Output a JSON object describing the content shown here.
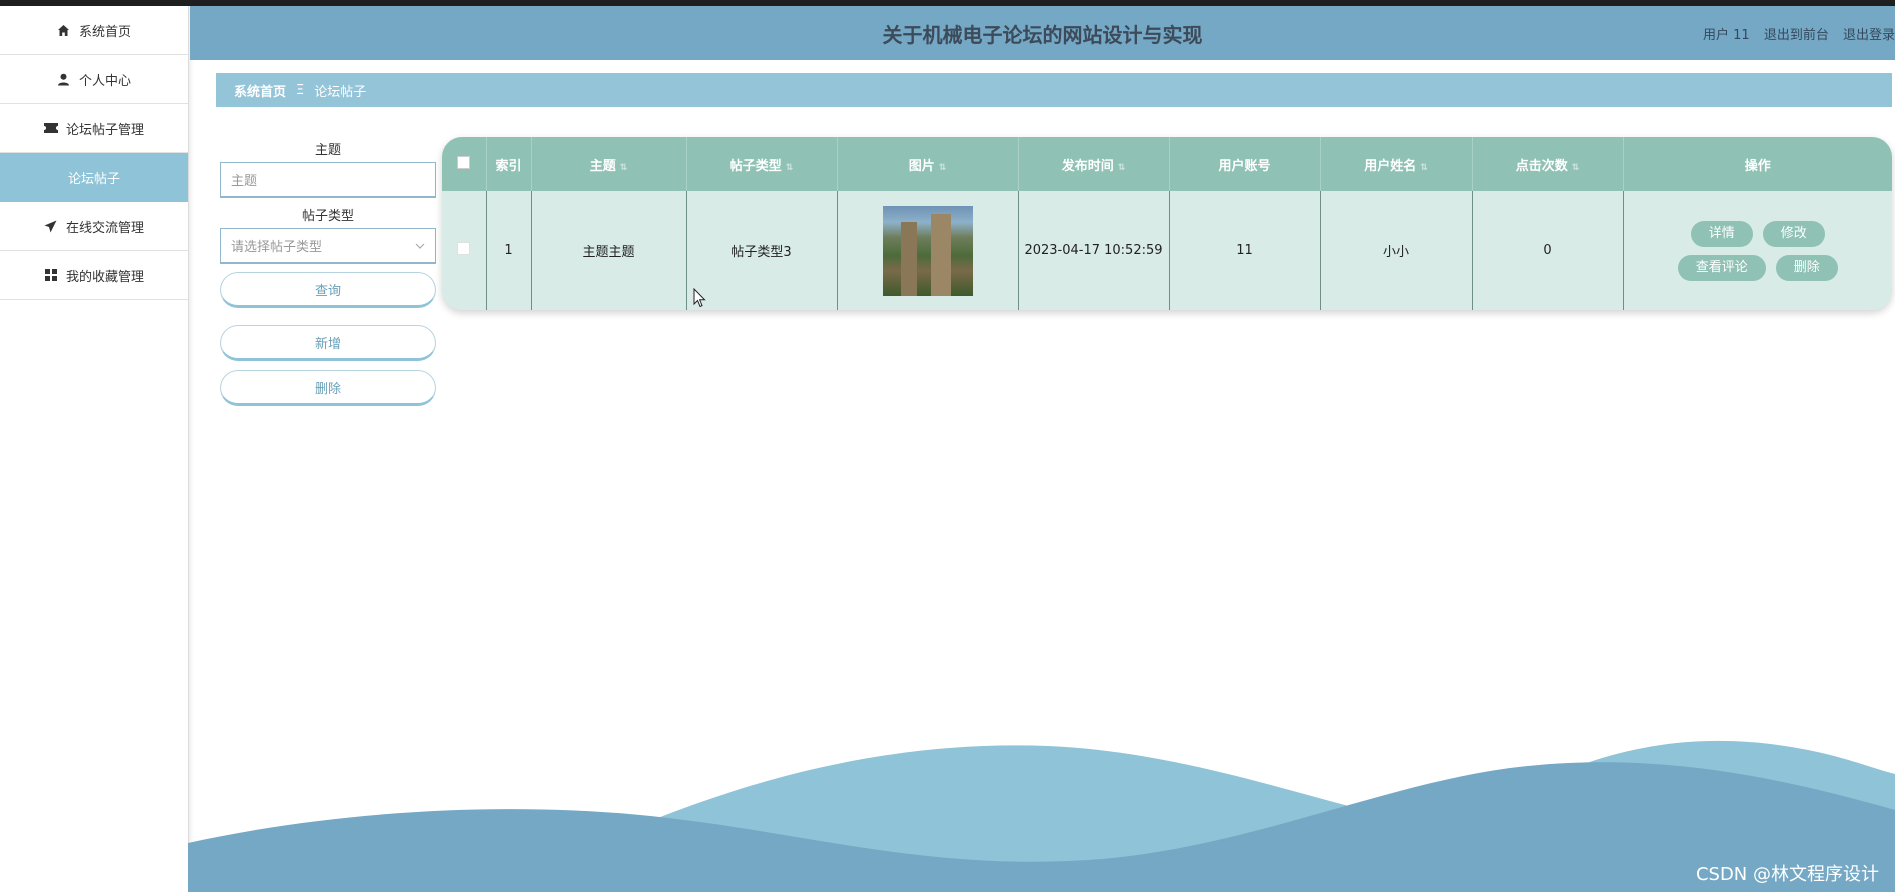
{
  "sidebar": {
    "items": [
      {
        "label": "系统首页",
        "icon": "home-icon"
      },
      {
        "label": "个人中心",
        "icon": "user-icon"
      },
      {
        "label": "论坛帖子管理",
        "icon": "ticket-icon"
      },
      {
        "label": "论坛帖子",
        "icon": ""
      },
      {
        "label": "在线交流管理",
        "icon": "send-icon"
      },
      {
        "label": "我的收藏管理",
        "icon": "grid-icon"
      }
    ]
  },
  "header": {
    "title": "关于机械电子论坛的网站设计与实现",
    "user": "用户 11",
    "exit_front": "退出到前台",
    "logout": "退出登录"
  },
  "breadcrumb": {
    "home": "系统首页",
    "separator": "Ξ",
    "current": "论坛帖子"
  },
  "filter": {
    "subject_label": "主题",
    "subject_placeholder": "主题",
    "type_label": "帖子类型",
    "type_placeholder": "请选择帖子类型",
    "query_button": "查询",
    "add_button": "新增",
    "delete_button": "删除"
  },
  "table": {
    "headers": [
      "索引",
      "主题",
      "帖子类型",
      "图片",
      "发布时间",
      "用户账号",
      "用户姓名",
      "点击次数",
      "操作"
    ],
    "rows": [
      {
        "index": "1",
        "subject": "主题主题",
        "type": "帖子类型3",
        "publish_time": "2023-04-17 10:52:59",
        "account": "11",
        "name": "小小",
        "clicks": "0",
        "actions": {
          "detail": "详情",
          "edit": "修改",
          "comments": "查看评论",
          "delete": "删除"
        }
      }
    ]
  },
  "watermark": "CSDN @林文程序设计",
  "colors": {
    "header": "#74a8c4",
    "breadcrumb": "#93c4d8",
    "table_header": "#8fc1b4",
    "table_row": "#d8ebe6",
    "active_sidebar": "#8fc3d7"
  }
}
